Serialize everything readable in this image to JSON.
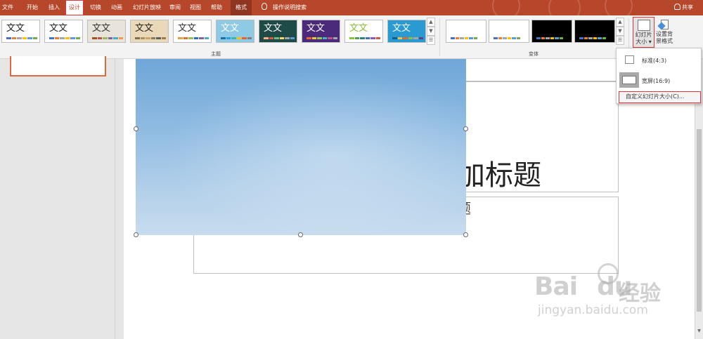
{
  "menubar": {
    "tabs": [
      {
        "label": "文件",
        "active": false
      },
      {
        "label": "开始",
        "active": false
      },
      {
        "label": "插入",
        "active": false
      },
      {
        "label": "设计",
        "active": true
      },
      {
        "label": "切换",
        "active": false
      },
      {
        "label": "动画",
        "active": false
      },
      {
        "label": "幻灯片放映",
        "active": false
      },
      {
        "label": "审阅",
        "active": false
      },
      {
        "label": "视图",
        "active": false
      },
      {
        "label": "帮助",
        "active": false
      },
      {
        "label": "格式",
        "active": false
      }
    ],
    "tell_me": "操作说明搜索",
    "share": "共享",
    "accent_color": "#b7472a"
  },
  "ribbon": {
    "themes": {
      "label": "主题",
      "thumb_text": "文文",
      "items": [
        {
          "bg": "#ffffff",
          "fg": "#222222",
          "bars": [
            "#4472c4",
            "#ed7d31",
            "#a5a5a5",
            "#ffc000",
            "#5b9bd5",
            "#70ad47"
          ]
        },
        {
          "bg": "#ffffff",
          "fg": "#222222",
          "bars": [
            "#4472c4",
            "#ed7d31",
            "#a5a5a5",
            "#ffc000",
            "#5b9bd5",
            "#70ad47"
          ]
        },
        {
          "bg": "#e8e4dc",
          "fg": "#333333",
          "bars": [
            "#a0522d",
            "#c0504d",
            "#9bbb59",
            "#8064a2",
            "#4bacc6",
            "#f79646"
          ]
        },
        {
          "bg": "#e9d9b8",
          "fg": "#222222",
          "bars": [
            "#7f6f50",
            "#b0905a",
            "#c9a86a",
            "#8a7a5a",
            "#5e5e5e",
            "#a07c4a"
          ]
        },
        {
          "bg": "#ffffff",
          "fg": "#333333",
          "bars": [
            "#e5a33c",
            "#d8742e",
            "#9bbb59",
            "#2d6fb7",
            "#8064a2",
            "#4bacc6"
          ]
        },
        {
          "bg": "#8ecae6",
          "fg": "#ffffff",
          "bars": [
            "#1f6f9c",
            "#2aa0d8",
            "#3cb5b0",
            "#ffc000",
            "#e0633a",
            "#7f7f7f"
          ]
        },
        {
          "bg": "#1e4b48",
          "fg": "#ffffff",
          "bars": [
            "#f4b183",
            "#d35a3a",
            "#6dbd8a",
            "#ffd966",
            "#a5a5a5",
            "#5b9bd5"
          ]
        },
        {
          "bg": "#4b2a7b",
          "fg": "#ffffff",
          "bars": [
            "#e56b2e",
            "#f2c140",
            "#8fc94b",
            "#3fb3c8",
            "#c04f8c",
            "#a5a5a5"
          ]
        },
        {
          "bg": "#ffffff",
          "fg": "#8bbf3c",
          "bars": [
            "#8bbf3c",
            "#4c9f4c",
            "#2f7f7f",
            "#3f6fbf",
            "#8a5aaf",
            "#d35a3a"
          ]
        },
        {
          "bg": "#2a9ad2",
          "fg": "#ffffff",
          "bars": [
            "#0f5f8f",
            "#f0c040",
            "#e06a2a",
            "#8bbf3c",
            "#a5a5a5",
            "#5f3f8f"
          ]
        }
      ]
    },
    "variants": {
      "label": "变体",
      "items": [
        {
          "bg": "#ffffff",
          "bars": [
            "#4472c4",
            "#ed7d31",
            "#a5a5a5",
            "#ffc000",
            "#5b9bd5",
            "#70ad47"
          ]
        },
        {
          "bg": "#ffffff",
          "bars": [
            "#4472c4",
            "#ed7d31",
            "#a5a5a5",
            "#ffc000",
            "#5b9bd5",
            "#70ad47"
          ]
        },
        {
          "bg": "#000000",
          "bars": [
            "#4472c4",
            "#ed7d31",
            "#a5a5a5",
            "#ffc000",
            "#5b9bd5",
            "#70ad47"
          ]
        },
        {
          "bg": "#000000",
          "bars": [
            "#4472c4",
            "#ed7d31",
            "#a5a5a5",
            "#ffc000",
            "#5b9bd5",
            "#70ad47"
          ]
        }
      ]
    },
    "slide_size_button": {
      "line1": "幻灯片",
      "line2": "大小 ▾"
    },
    "format_bg_button": {
      "line1": "设置背",
      "line2": "景格式"
    }
  },
  "dropdown": {
    "items": [
      {
        "label": "标准(4:3)"
      },
      {
        "label": "宽屏(16:9)"
      }
    ],
    "custom_label": "自定义幻灯片大小(C)..."
  },
  "slide": {
    "title_visible": "加标题",
    "subtitle_visible": "题"
  },
  "watermark": {
    "brand": "Bai",
    "brand2": "du",
    "brand_cn": "经验",
    "url": "jingyan.baidu.com"
  }
}
